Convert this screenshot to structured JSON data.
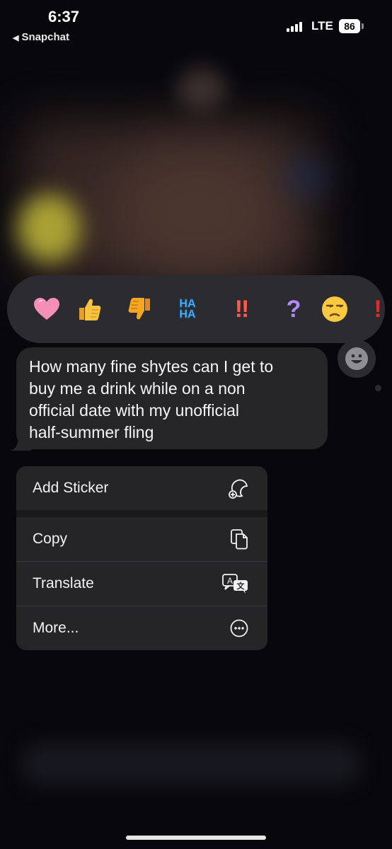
{
  "status_bar": {
    "time": "6:37",
    "back_app": "Snapchat",
    "network": "LTE",
    "battery": "86"
  },
  "reactions": [
    {
      "icon": "heart-icon"
    },
    {
      "icon": "thumbs-up-icon"
    },
    {
      "icon": "thumbs-down-icon"
    },
    {
      "icon": "haha-icon",
      "line1": "HA",
      "line2": "HA"
    },
    {
      "icon": "double-exclamation-icon",
      "text": "‼"
    },
    {
      "icon": "question-icon",
      "text": "?"
    },
    {
      "icon": "unamused-face-icon"
    },
    {
      "icon": "exclamation-icon",
      "text": "!"
    }
  ],
  "message": {
    "lines": [
      "How many fine shytes can I get to",
      "buy me a drink while on a non",
      "official date with my unofficial",
      "half-summer fling"
    ]
  },
  "context_menu": {
    "items": [
      {
        "label": "Add Sticker",
        "icon": "add-sticker-icon"
      },
      {
        "label": "Copy",
        "icon": "copy-icon"
      },
      {
        "label": "Translate",
        "icon": "translate-icon"
      },
      {
        "label": "More...",
        "icon": "more-icon"
      }
    ]
  },
  "colors": {
    "background": "#08080c",
    "surface": "#2c2c30",
    "bubble": "#262629",
    "menu": "#252528"
  }
}
